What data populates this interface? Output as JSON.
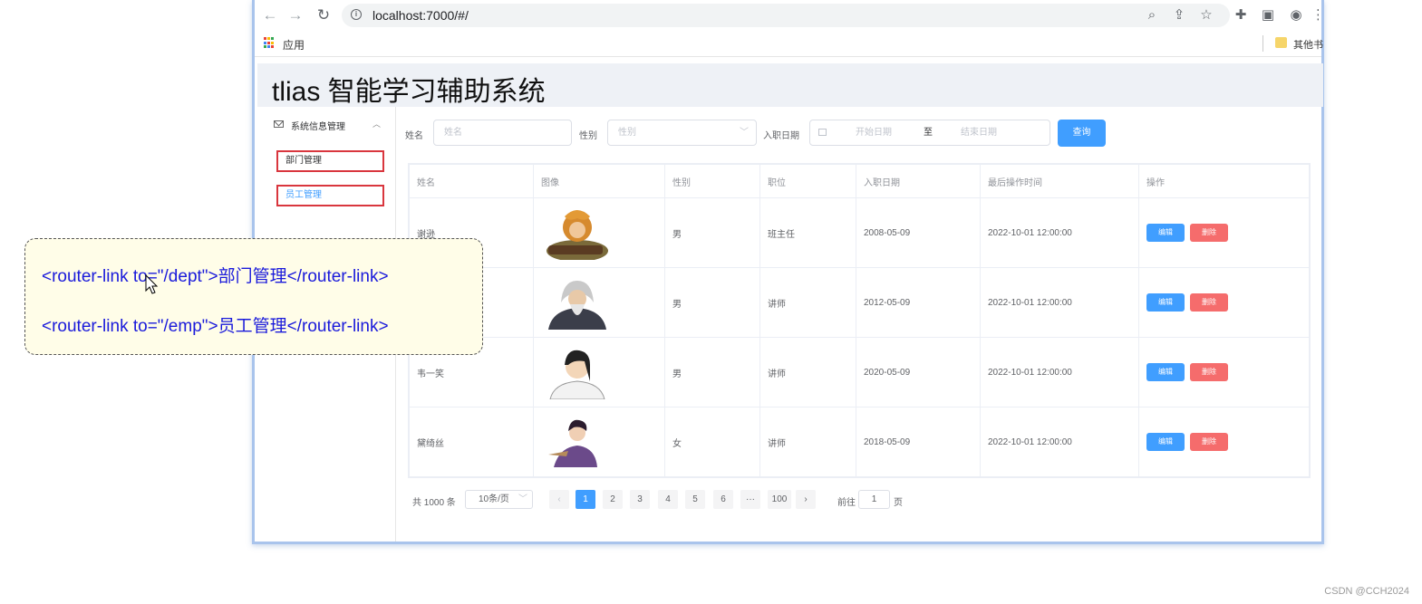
{
  "browser": {
    "url": "localhost:7000/#/",
    "bookmarks": {
      "apps_label": "应用",
      "other_label": "其他书"
    }
  },
  "app": {
    "title": "tlias 智能学习辅助系统"
  },
  "sidebar": {
    "group_title": "系统信息管理",
    "items": [
      {
        "label": "部门管理",
        "active": false
      },
      {
        "label": "员工管理",
        "active": true
      }
    ]
  },
  "search": {
    "name_label": "姓名",
    "name_placeholder": "姓名",
    "gender_label": "性别",
    "gender_placeholder": "性别",
    "date_label": "入职日期",
    "date_start_placeholder": "开始日期",
    "date_sep": "至",
    "date_end_placeholder": "结束日期",
    "query_button": "查询"
  },
  "table": {
    "columns": [
      "姓名",
      "图像",
      "性别",
      "职位",
      "入职日期",
      "最后操作时间",
      "操作"
    ],
    "rows": [
      {
        "name": "谢逊",
        "avatar": "golden-lion-avatar",
        "gender": "男",
        "job": "班主任",
        "entry_date": "2008-05-09",
        "update_time": "2022-10-01 12:00:00"
      },
      {
        "name": "",
        "avatar": "old-master-avatar",
        "gender": "男",
        "job": "讲师",
        "entry_date": "2012-05-09",
        "update_time": "2022-10-01 12:00:00"
      },
      {
        "name": "韦一笑",
        "avatar": "bat-king-avatar",
        "gender": "男",
        "job": "讲师",
        "entry_date": "2020-05-09",
        "update_time": "2022-10-01 12:00:00"
      },
      {
        "name": "黛绮丝",
        "avatar": "purple-dragon-avatar",
        "gender": "女",
        "job": "讲师",
        "entry_date": "2018-05-09",
        "update_time": "2022-10-01 12:00:00"
      }
    ],
    "edit_label": "编辑",
    "delete_label": "删除"
  },
  "pagination": {
    "total": "共 1000 条",
    "page_size": "10条/页",
    "pages": [
      "1",
      "2",
      "3",
      "4",
      "5",
      "6",
      "···",
      "100"
    ],
    "current": "1",
    "goto_label": "前往",
    "goto_value": "1",
    "goto_unit": "页"
  },
  "callout": {
    "line1": "<router-link to=\"/dept\">部门管理</router-link>",
    "line2": "<router-link to=\"/emp\">员工管理</router-link>"
  },
  "watermark": "CSDN @CCH2024",
  "colors": {
    "primary": "#409eff",
    "danger": "#f56c6c",
    "highlight_border": "#d9363e",
    "code_text": "#1a1adb"
  }
}
